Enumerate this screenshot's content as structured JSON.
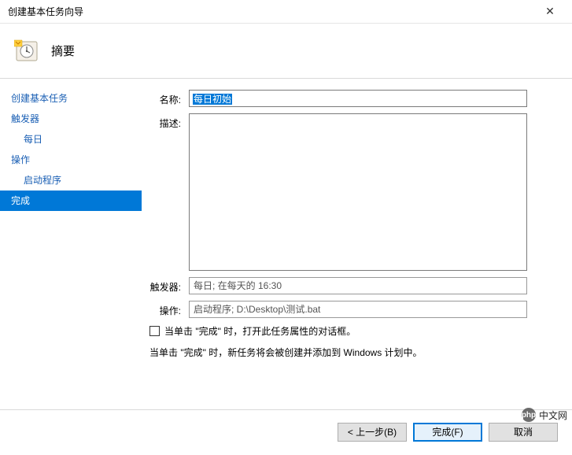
{
  "window": {
    "title": "创建基本任务向导"
  },
  "header": {
    "title": "摘要"
  },
  "sidebar": {
    "items": [
      {
        "label": "创建基本任务",
        "indent": false,
        "selected": false
      },
      {
        "label": "触发器",
        "indent": false,
        "selected": false
      },
      {
        "label": "每日",
        "indent": true,
        "selected": false
      },
      {
        "label": "操作",
        "indent": false,
        "selected": false
      },
      {
        "label": "启动程序",
        "indent": true,
        "selected": false
      },
      {
        "label": "完成",
        "indent": false,
        "selected": true
      }
    ]
  },
  "form": {
    "name_label": "名称:",
    "name_value": "每日初始",
    "desc_label": "描述:",
    "desc_value": "",
    "trigger_label": "触发器:",
    "trigger_value": "每日;  在每天的 16:30",
    "action_label": "操作:",
    "action_value": "启动程序; D:\\Desktop\\测试.bat",
    "checkbox_label": "当单击 \"完成\" 时，打开此任务属性的对话框。",
    "info": "当单击 \"完成\" 时，新任务将会被创建并添加到 Windows 计划中。"
  },
  "footer": {
    "back": "< 上一步(B)",
    "finish": "完成(F)",
    "cancel": "取消"
  },
  "watermark": {
    "logo": "php",
    "text": "中文网"
  }
}
